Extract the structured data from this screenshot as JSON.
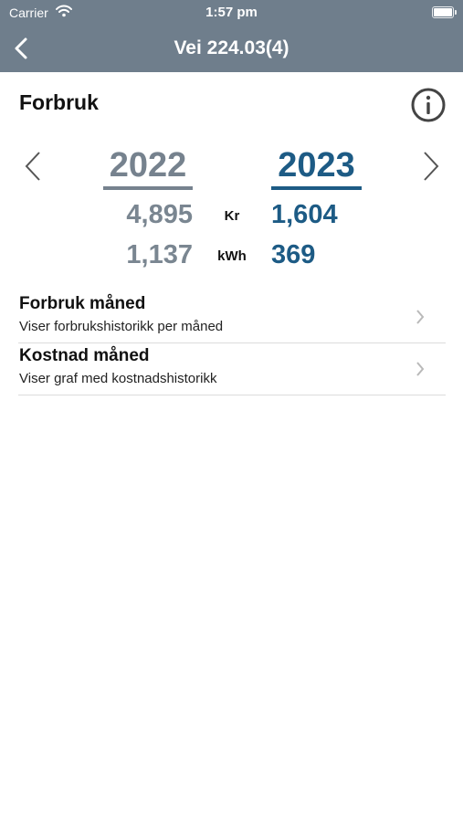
{
  "status_bar": {
    "carrier": "Carrier",
    "time": "1:57 pm"
  },
  "navbar": {
    "title": "Vei 224.03(4)",
    "back_icon": "chevron-left-icon"
  },
  "page": {
    "title": "Forbruk",
    "info_icon": "info-circle-icon"
  },
  "comparison": {
    "prev_year": "2022",
    "curr_year": "2023",
    "rows": [
      {
        "unit": "Kr",
        "prev": "4,895",
        "curr": "1,604"
      },
      {
        "unit": "kWh",
        "prev": "1,137",
        "curr": "369"
      }
    ]
  },
  "menu": [
    {
      "title": "Forbruk måned",
      "subtitle": "Viser forbrukshistorikk per måned"
    },
    {
      "title": "Kostnad måned",
      "subtitle": "Viser graf med kostnadshistorikk"
    }
  ],
  "colors": {
    "header": "#6f7e8c",
    "accent": "#1d5b85",
    "muted": "#76828e"
  }
}
